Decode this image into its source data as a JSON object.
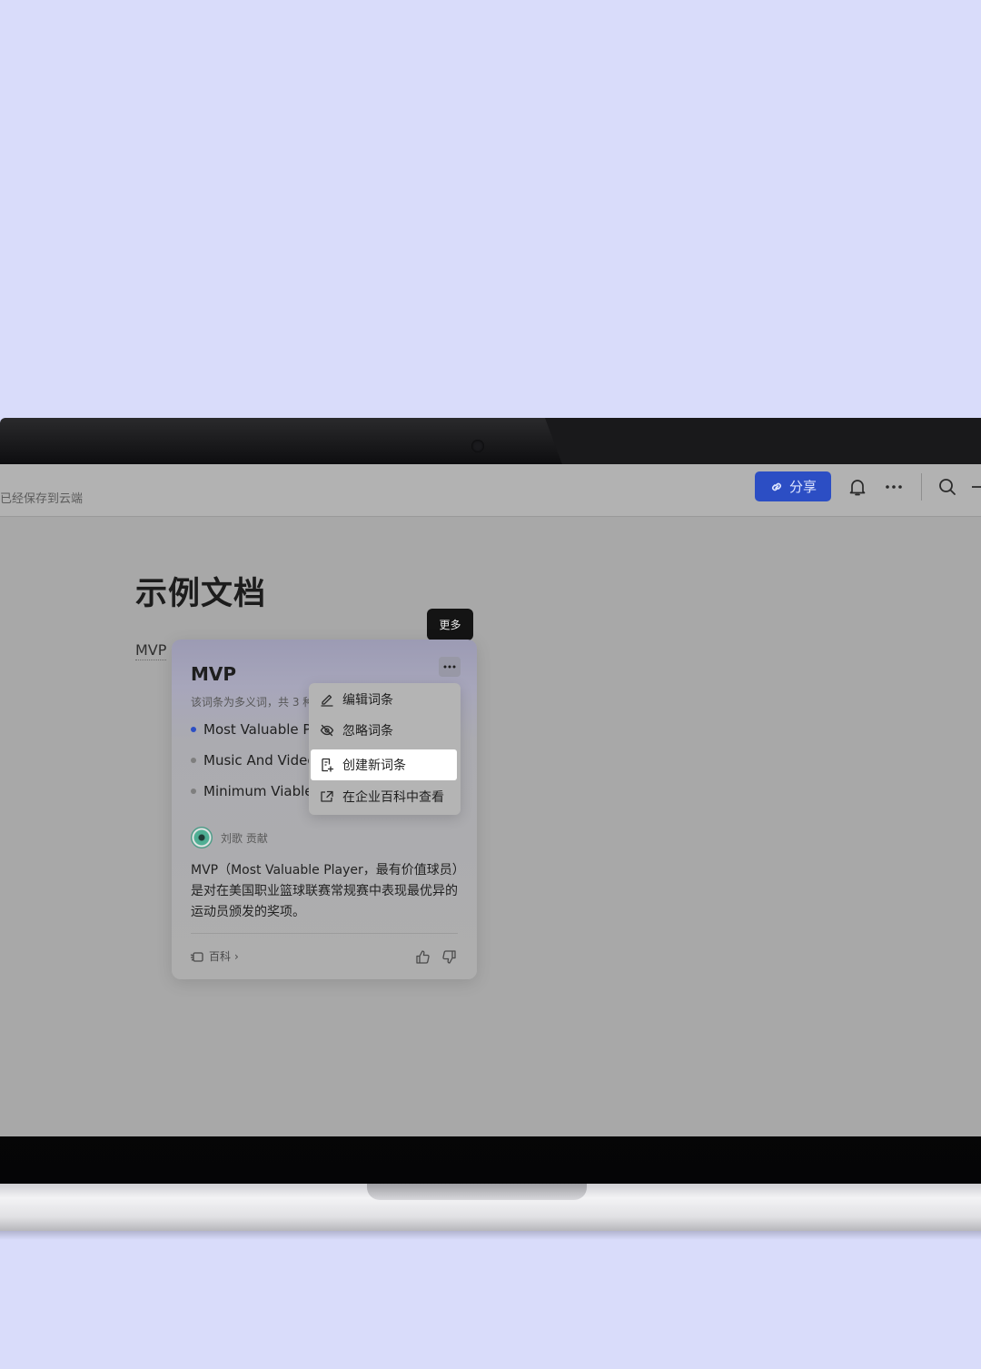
{
  "topbar": {
    "save_status": "已经保存到云端",
    "share_label": "分享"
  },
  "doc": {
    "title": "示例文档",
    "inline_term": "MVP"
  },
  "tooltip": {
    "text": "更多"
  },
  "card": {
    "title": "MVP",
    "subtitle": "该词条为多义词，共 3 种",
    "meanings": [
      {
        "label": "Most Valuable Player",
        "active": true
      },
      {
        "label": "Music And Video",
        "active": false
      },
      {
        "label": "Minimum Viable Product",
        "active": false
      }
    ],
    "contributor": "刘歌 贡献",
    "description": "MVP（Most Valuable Player，最有价值球员）是对在美国职业篮球联赛常规赛中表现最优异的运动员颁发的奖项。",
    "source_link": "百科",
    "source_chevron": "›"
  },
  "menu": {
    "items": [
      {
        "label": "编辑词条",
        "icon": "edit-icon"
      },
      {
        "label": "忽略词条",
        "icon": "eye-off-icon"
      },
      {
        "label": "创建新词条",
        "icon": "new-doc-icon"
      },
      {
        "label": "在企业百科中查看",
        "icon": "open-external-icon"
      }
    ],
    "highlighted_index": 2
  },
  "colors": {
    "background": "#d9dcfa",
    "accent": "#2c4ec4"
  }
}
